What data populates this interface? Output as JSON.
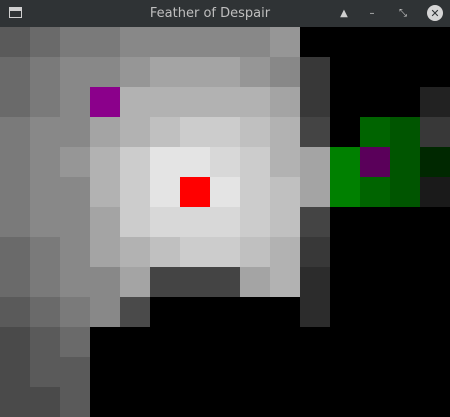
{
  "window": {
    "title": "Feather of Despair",
    "icons": {
      "app": "app-window-icon",
      "shade": "shade-up-icon",
      "minimize": "minimize-icon",
      "restore": "restore-icon",
      "close": "close-icon"
    },
    "glyphs": {
      "shade": "▲",
      "minimize": "–",
      "restore": "⤡",
      "close": "✕"
    }
  },
  "game": {
    "grid_cols": 15,
    "grid_rows": 13,
    "legend": {
      "0": null,
      "a": "#4a4a4a",
      "b": "#5a5a5a",
      "c": "#6a6a6a",
      "d": "#7a7a7a",
      "e": "#888888",
      "f": "#969696",
      "g": "#a4a4a4",
      "h": "#b2b2b2",
      "i": "#c0c0c0",
      "j": "#cccccc",
      "k": "#d8d8d8",
      "l": "#e4e4e4",
      "m": "#eeeeee",
      "n": "#2c2c2c",
      "o": "#383838",
      "p": "#444444",
      "q": "#1a1a1a",
      "r": "#222222",
      "R": "#ff0000",
      "P": "#8b008b",
      "Q": "#5a005a",
      "G": "#008000",
      "H": "#006400",
      "I": "#005500",
      "J": "#003b00",
      "K": "#002800",
      "L": "#007000"
    },
    "rows": [
      "bcddeeeeefe0000",
      "cdeefgggfee0000",
      "cdeePhhhhg0n00r",
      "deeghijjihg0HI",
      "deefhjllkjhgGQIJK",
      "deeghjlRlkjhLHIq",
      "deeghjkkkjih0000",
      "cdefhijjjih0000",
      "cdeegipppg0000",
      "bcdeeoo000n0000",
      "abcc00000000000",
      "abbb00000000000",
      "aabb00000000000"
    ],
    "player_tile": "player-marker",
    "item_tile": "purple-item-marker"
  }
}
